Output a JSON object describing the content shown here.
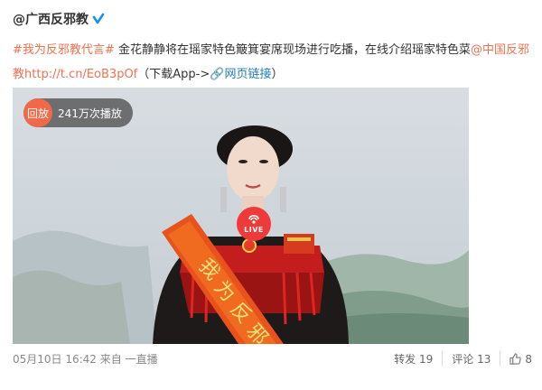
{
  "post": {
    "author": "@广西反邪教",
    "hashtag": "#我为反邪教代言#",
    "text_main": "金花静静将在瑶家特色簸箕宴席现场进行吃播，在线介绍瑶家特色菜",
    "mention": "@中国反邪教",
    "short_link": "http://t.cn/EoB3pOf",
    "link_paren_open": "（",
    "download_label": "下载App->",
    "webpage_label": "网页链接",
    "link_paren_close": "）"
  },
  "video": {
    "replay_label": "回放",
    "play_count": "241万次播放",
    "live_label": "LIVE"
  },
  "footer": {
    "date": "05月10日 16:42",
    "from_prefix": "来自",
    "source": "一直播",
    "repost_label": "转发 19",
    "comment_label": "评论 13",
    "like_count": "8"
  },
  "colors": {
    "accent": "#eb7350",
    "link_blue": "#1f79b7",
    "live_red": "#ef3a3a",
    "verified_blue": "#1890e8"
  }
}
